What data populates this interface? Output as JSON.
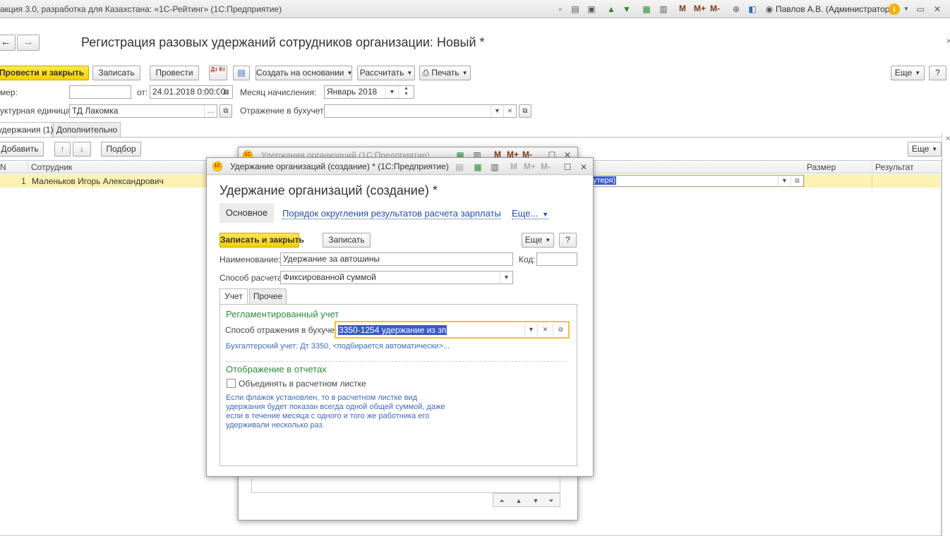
{
  "app": {
    "title": "акция 3.0, разработка для Казахстана: «1С-Рейтинг» (1С:Предприятие)",
    "user": "Павлов А.В. (Администратор)",
    "m_labels": [
      "M",
      "M+",
      "M-"
    ]
  },
  "doc": {
    "nav_back": "←",
    "nav_forward": "→",
    "title": "Регистрация разовых удержаний сотрудников организации: Новый *",
    "toolbar": {
      "post_close": "Провести и закрыть",
      "save": "Записать",
      "post": "Провести",
      "dtkt": "Дт Кт",
      "create_based": "Создать на основании",
      "calculate": "Рассчитать",
      "print": "Печать",
      "more": "Еще",
      "help": "?"
    },
    "number_label": "мер:",
    "number_value": "",
    "from_label": "от:",
    "date_value": "24.01.2018  0:00:00",
    "month_label": "Месяц начисления:",
    "month_value": "Январь 2018",
    "unit_label": "уктурная единица:",
    "unit_value": "ТД Лакомка",
    "reflect_label": "Отражение в бухучете:",
    "reflect_value": "",
    "tabs": [
      "удержания (1)",
      "Дополнительно"
    ],
    "table_toolbar": {
      "add": "Добавить",
      "up": "↑",
      "down": "↓",
      "select": "Подбор",
      "more": "Еще"
    },
    "columns": {
      "n": "N",
      "employee": "Сотрудник",
      "size": "Размер",
      "result": "Результат"
    },
    "rows": [
      {
        "n": "1",
        "employee": "Маленьков Игорь Александрович",
        "deduction_partial": "утеря)"
      }
    ]
  },
  "bg_window": {
    "title": "Удержания организаций  (1С:Предприятие)"
  },
  "dialog": {
    "window_title": "Удержание организаций (создание) *  (1С:Предприятие)",
    "heading": "Удержание организаций (создание) *",
    "nav": {
      "main": "Основное",
      "rounding": "Порядок округления результатов расчета зарплаты",
      "more": "Еще..."
    },
    "toolbar": {
      "save_close": "Записать и закрыть",
      "save": "Записать",
      "more": "Еще",
      "help": "?"
    },
    "name_label": "Наименование:",
    "name_value": "Удержание за автошины",
    "code_label": "Код:",
    "code_value": "",
    "method_label": "Способ расчета:",
    "method_value": "Фиксированной суммой",
    "tabs": [
      "Учет",
      "Прочее"
    ],
    "reg_heading": "Регламентированный учет",
    "reflect_method_label": "Способ отражения в бухучете:",
    "reflect_method_value": "3350-1254 удержание из зп",
    "acct_info": "Бухгалтерский учет: Дт 3350, <подбирается автоматически>...",
    "reports_heading": "Отображение в отчетах",
    "combine_label": "Объединять в расчетном листке",
    "combine_checked": false,
    "hint_lines": [
      "Если флажок установлен, то в расчетном листке вид",
      "удержания будет показан всегда одной общей суммой, даже",
      "если в течение месяца с одного и того же работника его",
      "удерживали несколько раз."
    ]
  }
}
